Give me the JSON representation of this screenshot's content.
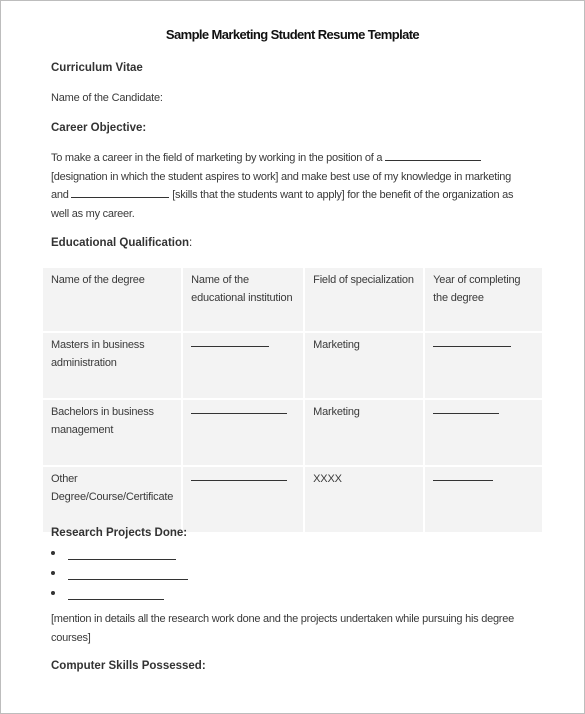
{
  "title": "Sample Marketing Student Resume Template",
  "sections": {
    "curriculum_vitae": "Curriculum Vitae",
    "candidate_name_label": "Name of the Candidate:",
    "career_objective": {
      "heading": "Career Objective:",
      "line1_prefix": "To make a career in the field of marketing by working in the position of a",
      "line2": "[designation in which the student aspires to work] and make best use of my knowledge in marketing",
      "line3_prefix": "and",
      "line3_suffix": "[skills that the students want to apply] for the benefit of the organization as",
      "line4": "well as my career."
    },
    "education": {
      "heading": "Educational Qualification",
      "heading_suffix": ":",
      "columns": [
        "Name of the degree",
        "Name of the educational institution",
        "Field of specialization",
        "Year of completing the degree"
      ],
      "rows": [
        {
          "degree": "Masters in business administration",
          "institution": "",
          "field": "Marketing",
          "year": ""
        },
        {
          "degree": "Bachelors in business management",
          "institution": "",
          "field": "Marketing",
          "year": ""
        },
        {
          "degree": "Other Degree/Course/Certificate",
          "institution": "",
          "field": "XXXX",
          "year": ""
        }
      ]
    },
    "research": {
      "heading": "Research Projects Done:",
      "items": [
        "",
        "",
        ""
      ],
      "note": "[mention in details all the research work done and the projects undertaken while pursuing his degree courses]"
    },
    "computer_skills": {
      "heading": "Computer Skills Possessed:"
    }
  }
}
